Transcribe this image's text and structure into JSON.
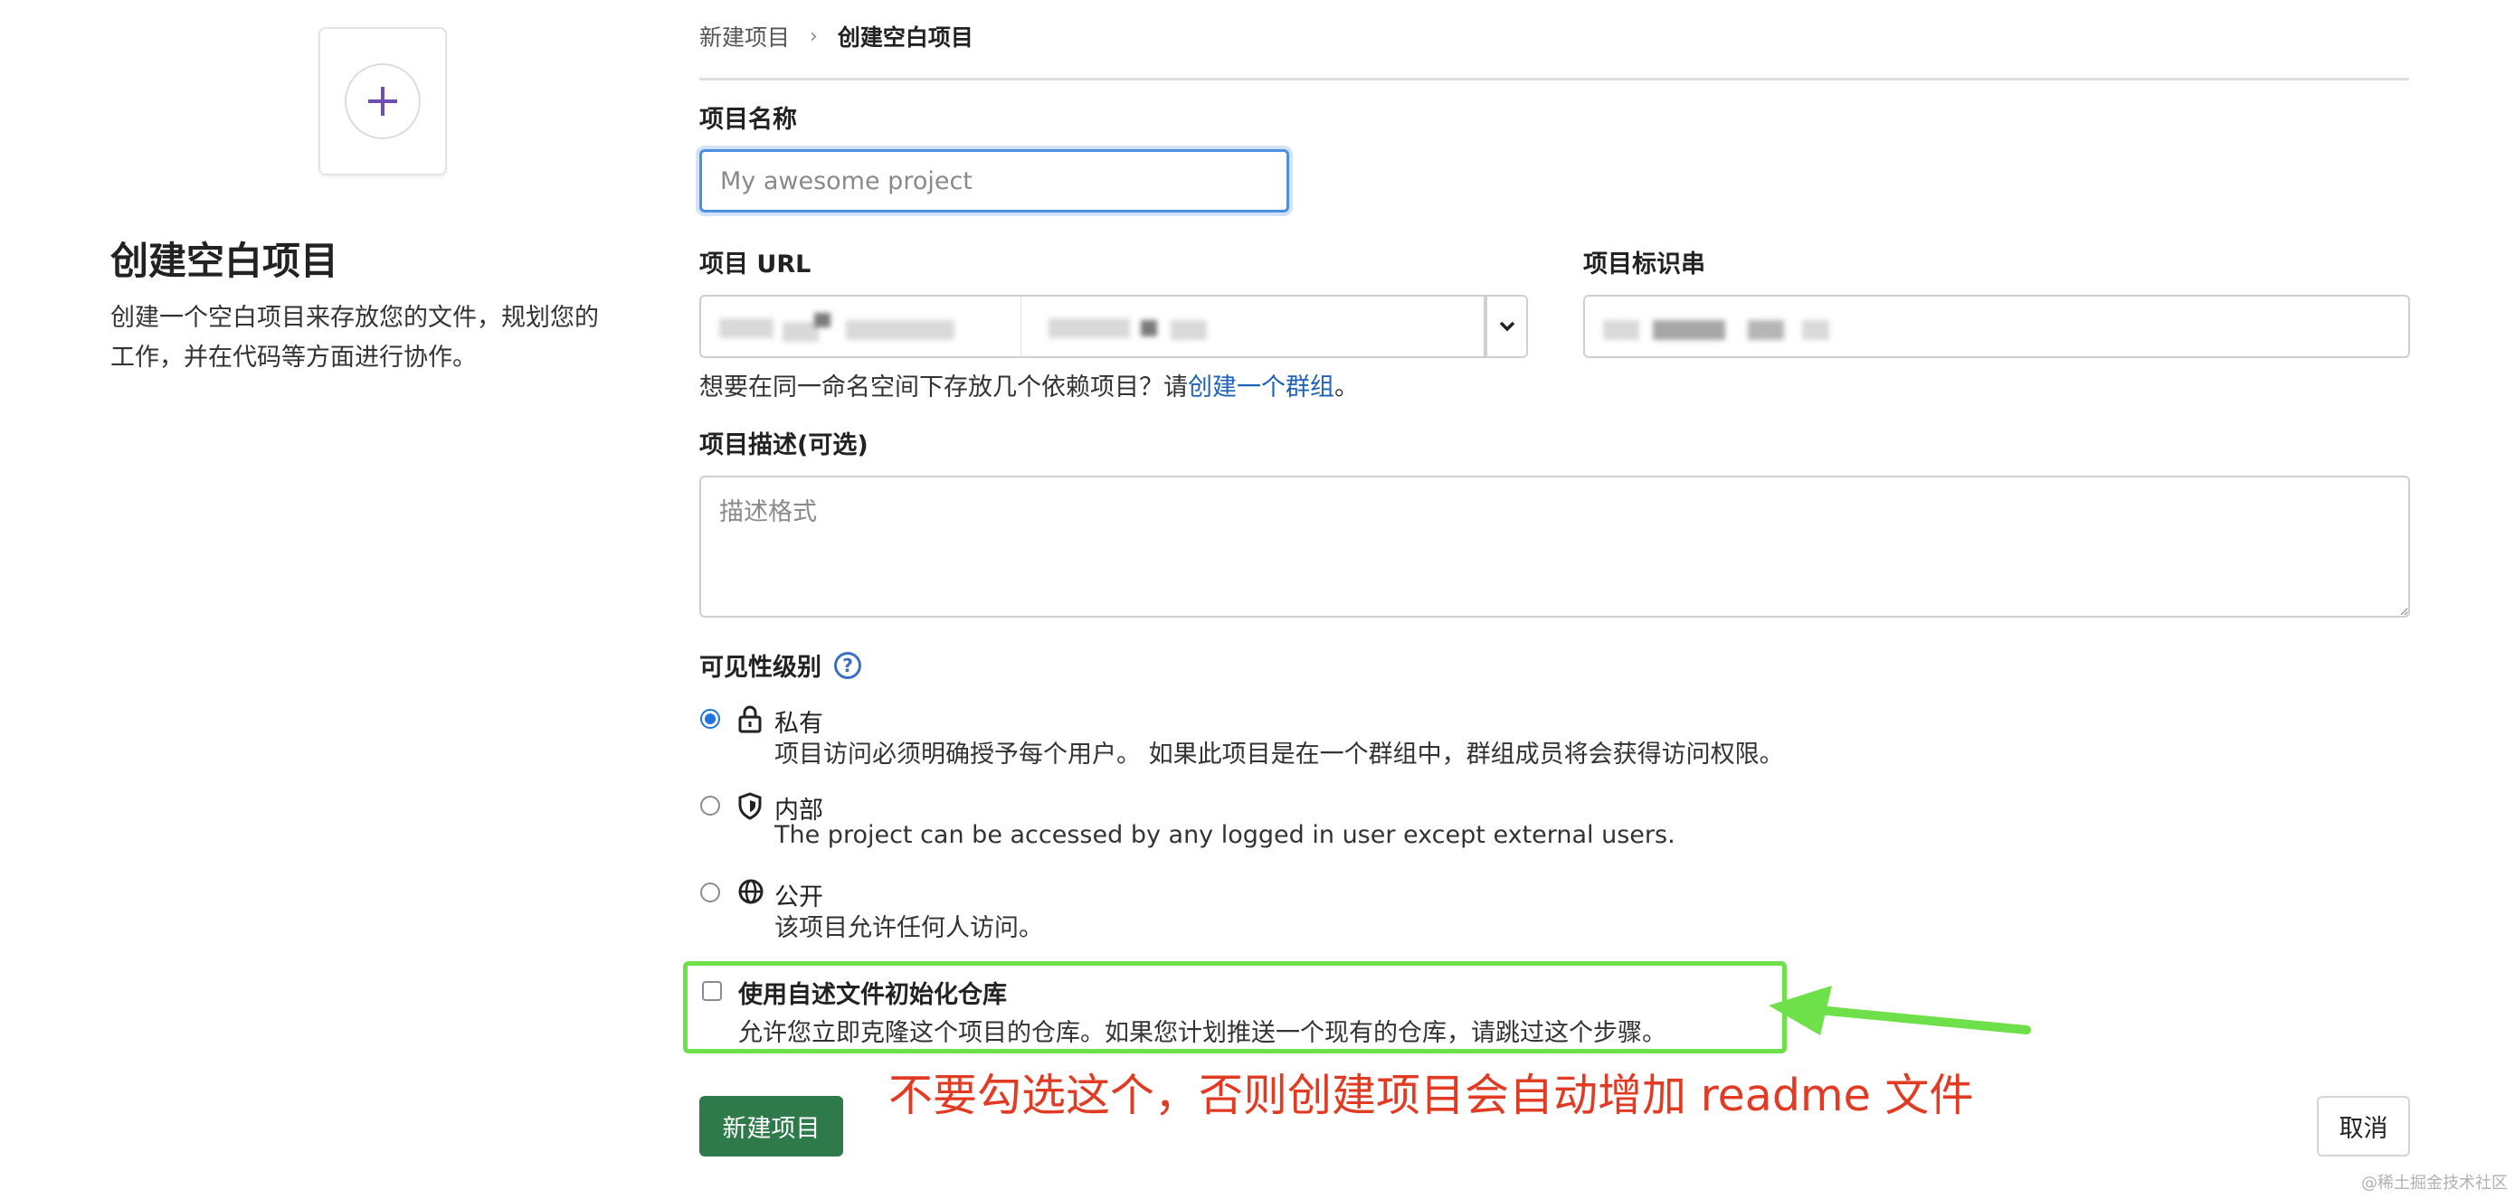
{
  "left": {
    "icon": "plus-icon",
    "title": "创建空白项目",
    "desc_line1": "创建一个空白项目来存放您的文件，规划您的",
    "desc_line2": "工作，并在代码等方面进行协作。"
  },
  "breadcrumb": {
    "parent": "新建项目",
    "current": "创建空白项目"
  },
  "form": {
    "name_label": "项目名称",
    "name_placeholder": "My awesome project",
    "url_label": "项目 URL",
    "slug_label": "项目标识串",
    "help_prefix": "想要在同一命名空间下存放几个依赖项目？请",
    "help_link": "创建一个群组",
    "help_suffix": "。",
    "desc_label": "项目描述(可选)",
    "desc_placeholder": "描述格式",
    "visibility_label": "可见性级别",
    "options": [
      {
        "title": "私有",
        "desc": "项目访问必须明确授予每个用户。 如果此项目是在一个群组中，群组成员将会获得访问权限。",
        "icon": "lock-icon",
        "checked": true
      },
      {
        "title": "内部",
        "desc": "The project can be accessed by any logged in user except external users.",
        "icon": "shield-icon",
        "checked": false
      },
      {
        "title": "公开",
        "desc": "该项目允许任何人访问。",
        "icon": "globe-icon",
        "checked": false
      }
    ],
    "readme_title": "使用自述文件初始化仓库",
    "readme_desc": "允许您立即克隆这个项目的仓库。如果您计划推送一个现有的仓库，请跳过这个步骤。",
    "readme_checked": false
  },
  "annotation": "不要勾选这个，否则创建项目会自动增加 readme 文件",
  "buttons": {
    "create": "新建项目",
    "cancel": "取消"
  },
  "watermark": "@稀土掘金技术社区",
  "colors": {
    "accent_blue": "#1f75e0",
    "link_blue": "#1f62b6",
    "primary_green": "#2f7a4a",
    "highlight_green": "#6ee04a",
    "annotation_red": "#e23b24"
  }
}
